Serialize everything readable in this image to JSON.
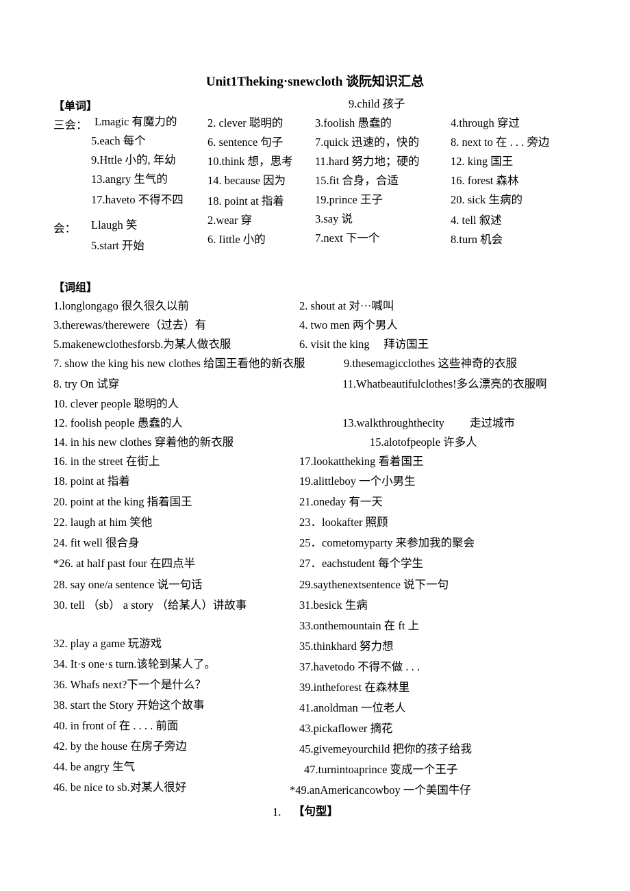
{
  "document": {
    "title_en": "Unit1Theking·snewcloth",
    "title_cn": "谈阮知识汇总"
  },
  "words_section": {
    "heading": "【单词】",
    "labels": {
      "three_skills": "三会：",
      "one_skill": "会："
    },
    "col1": [
      "Lmagic 有魔力的",
      "5.each 每个",
      "9.Httle 小的, 年幼",
      "13.angry 生气的",
      "17.haveto 不得不四",
      "Llaugh 笑",
      "5.start 开始"
    ],
    "col2": [
      "2. clever 聪明的",
      "6. sentence 句子",
      "10.think 想，思考",
      "14. because 因为",
      "18. point at 指着",
      "2.wear 穿",
      "6. Iittle 小的"
    ],
    "col3": [
      "9.child 孩子",
      "3.foolish 愚蠢的",
      "7.quick 迅速的，快的",
      "11.hard 努力地；硬的",
      "15.fit 合身，合适",
      "19.prince 王子",
      "3.say 说",
      "7.next 下一个"
    ],
    "col4": [
      "4.through 穿过",
      "8. next to 在 . . . 旁边",
      "12. king 国王",
      "16. forest 森林",
      "20. sick 生病的",
      "4. tell 叙述",
      "8.turn 机会"
    ]
  },
  "phrases_section": {
    "heading": "【词组】",
    "left": [
      "1.longlongago 很久很久以前",
      "3.therewas/therewere（过去）有",
      "5.makenewclothesforsb.为某人做衣服",
      "7. show the king his new clothes 给国王看他的新衣服",
      "8. try On 试穿",
      "10. clever people 聪明的人",
      "12. foolish people 愚蠢的人",
      "14. in his new clothes 穿着他的新衣服",
      "16. in the street 在街上",
      "18. point at 指着",
      "20. point at the king 指着国王",
      "22. laugh at him 笑他",
      "24. fit well 很合身",
      "*26. at half past four 在四点半",
      "28. say one/a sentence 说一句话",
      "30. tell （sb） a story （给某人）讲故事",
      "32. play a game 玩游戏",
      "34. It·s one·s turn.该轮到某人了。",
      "36. Whafs next?下一个是什么？",
      "38. start the Story 开始这个故事",
      "40. in front of 在 . . . . 前面",
      "42. by the house 在房子旁边",
      "44. be angry 生气",
      "46. be nice to sb.对某人很好"
    ],
    "right": [
      "2. shout at 对···喊叫",
      "4. two men 两个男人",
      "6. visit the king 　拜访国王",
      "9.thesemagicclothes 这些神奇的衣服",
      "11.Whatbeautifulclothes!多么漂亮的衣服啊",
      "13.walkthroughthecity 　　走过城市",
      "15.alotofpeople 许多人",
      "17.lookattheking 看着国王",
      "19.alittleboy 一个小男生",
      "21.oneday 有一天",
      "23．lookafter 照顾",
      "25．cometomyparty 来参加我的聚会",
      "27．eachstudent 每个学生",
      "29.saythenextsentence 说下一句",
      "31.besick 生病",
      "33.onthemountain 在 ft 上",
      "35.thinkhard 努力想",
      "37.havetodo 不得不做 . . .",
      "39.intheforest 在森林里",
      "41.anoldman 一位老人",
      "43.pickaflower 摘花",
      "45.givemeyourchild 把你的孩子给我",
      "47.turnintoaprince 变成一个王子",
      "*49.anAmericancowboy 一个美国牛仔"
    ]
  },
  "sentences_section": {
    "number": "1.",
    "heading": "【句型】"
  }
}
